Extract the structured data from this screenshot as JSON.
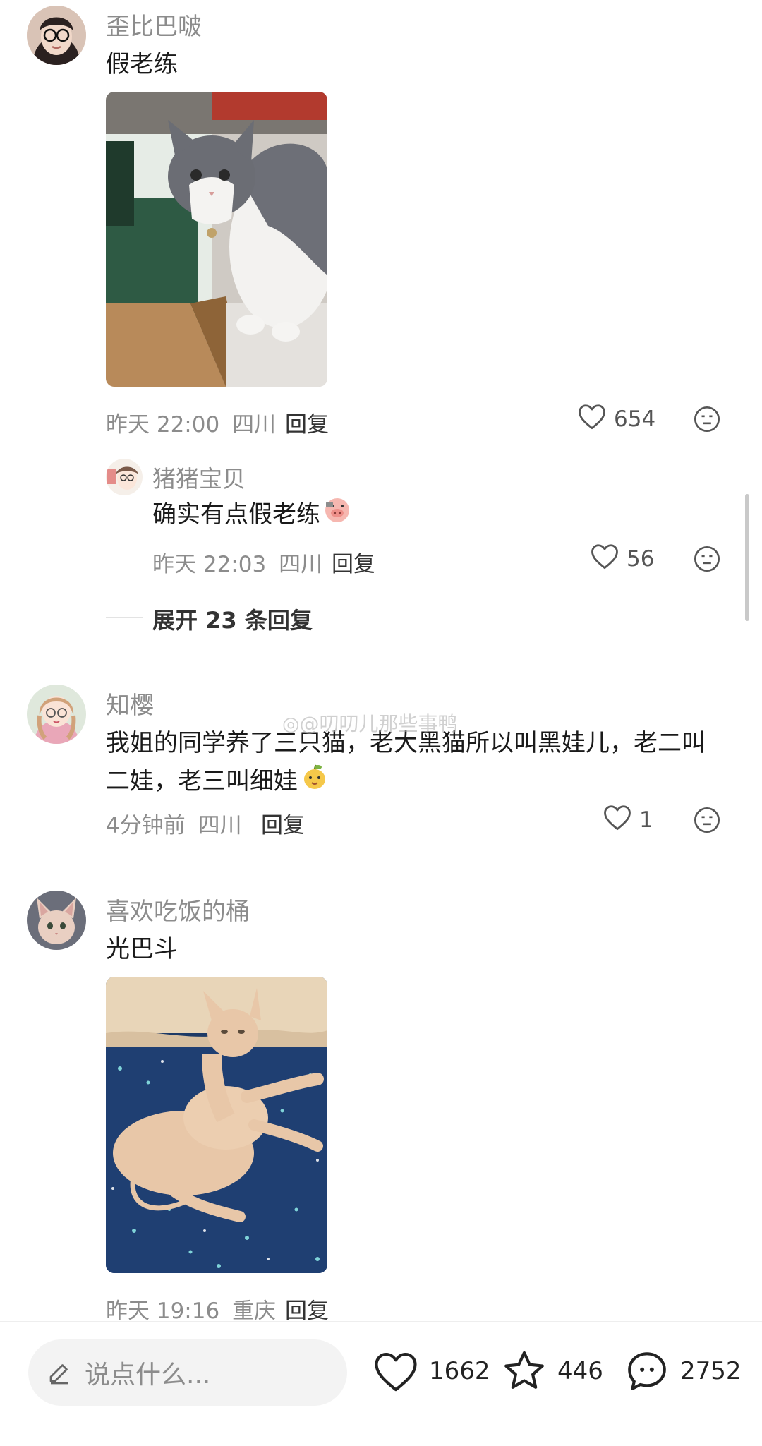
{
  "comments": [
    {
      "username": "歪比巴啵",
      "text": "假老练",
      "time": "昨天 22:00",
      "location": "四川",
      "reply_label": "回复",
      "likes": "654",
      "replies": [
        {
          "username": "猪猪宝贝",
          "text": "确实有点假老练",
          "time": "昨天 22:03",
          "location": "四川",
          "reply_label": "回复",
          "likes": "56"
        }
      ],
      "expand_label": "展开 23 条回复"
    },
    {
      "username": "知樱",
      "text": "我姐的同学养了三只猫，老大黑猫所以叫黑娃儿，老二叫二娃，老三叫细娃",
      "time": "4分钟前",
      "location": "四川",
      "reply_label": "回复",
      "likes": "1"
    },
    {
      "username": "喜欢吃饭的桶",
      "text": "光巴斗",
      "time": "昨天 19:16",
      "location": "重庆",
      "reply_label": "回复"
    }
  ],
  "watermark": "@叨叨儿那些事鸭",
  "bottom_bar": {
    "input_placeholder": "说点什么...",
    "like_count": "1662",
    "star_count": "446",
    "comment_count": "2752"
  },
  "icons": {
    "like": "heart-outline-icon",
    "dislike": "neutral-face-icon",
    "edit": "pencil-icon",
    "star": "star-outline-icon",
    "comment": "chat-bubble-icon"
  },
  "colors": {
    "muted_text": "#8c8c8c",
    "primary_text": "#1a1a1a",
    "input_bg": "#f3f3f3"
  }
}
